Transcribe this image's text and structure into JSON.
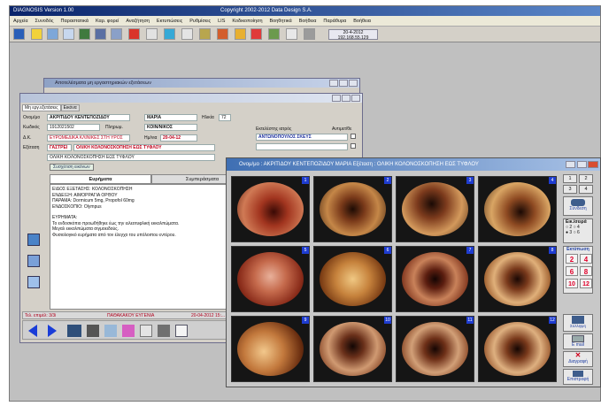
{
  "app": {
    "title": "DIAGNOSIS Version 1.00",
    "copyright": "Copyright 2002-2012 Data Design S.A."
  },
  "menu": [
    "Αρχεία",
    "Συνοδός",
    "Παραστατικά",
    "Καρ. φορεί",
    "Αναζήτηση",
    "Εκτυπώσεις",
    "Ρυθμίσεις",
    "LIS",
    "Κοδικοποίηση",
    "Βοηθητικά",
    "Βοήθεια",
    "Παράθυρα",
    "Βοήθεια"
  ],
  "datetime": {
    "date": "20-4-2012",
    "ip": "192.168.55.129"
  },
  "bg_window": {
    "title": "Αποτελέσματα μη εργαστηριακών εξετάσεων"
  },
  "patient_window": {
    "tabs": [
      "Μη εργ.εξετάσεις",
      "Εικόνα"
    ],
    "name_label": "Ονομ/μο",
    "surname": "ΑΚΡΙΤΙΔΟΥ ΚΕΝΤΕΠΟΖΙΔΟΥ",
    "first_name": "ΜΑΡΙΑ",
    "age_label": "Ηλικία",
    "age": "72",
    "code_label": "Κωδικός",
    "code": "1912021502",
    "payer_label": "Πληρωμ.",
    "payer": "ΚΟΙΝ/ΝΙΚΟΣ",
    "doctor_label": "Δ.Κ.",
    "doctor": "ΕΥΡΩΜΕΔΙΚΑ ΚΛΙΝΙΚΕΣ ΣΤΗ ΥΡΟΣ",
    "date_label": "Ημ/νια",
    "date": "20-04-12",
    "exam_label": "Εξέταση",
    "exam_code": "ΓΑΣΤΡΕΙ",
    "exam": "ΟΛΙΚΗ ΚΟΛΟΝΟΣΚΟΠΗΣΗ ΕΩΣ ΤΥΦΛΟΥ",
    "exam_line": "ΟΛΙΚΗ ΚΟΛΟΝΟΣΚΟΠΗΣΗ ΕΩΣ ΤΥΦΛΟΥ",
    "link_btn": "Συσχέτιση εικόνων",
    "sub_tabs": [
      "Ευρήματα",
      "Συμπεράσματα"
    ],
    "report": [
      "ΕΙΔΟΣ ΕΞΕΤΑΣΗΣ: ΚΟΛΟΝΟΣΚΟΠΗΣΗ",
      "ΕΝΔΕΙΞΗ: ΑΙΜΟΡΡΑΓΙΑ ΟΡΘΟΥ",
      "ΠΑΡΑΜΑ: Dormicum 5mg, Propofol 60mg",
      "ΕΝΔΟΣΚΟΠΙΟ: Olympus",
      "",
      "ΕΥΡΗΜΑΤΑ:",
      "Το ενδοσκόπιο προωθήθηκε έως την ειλεοτυφλική εκκολπώματα.",
      "Μεγαλ εκκολπώματα σιγμοειδούς.",
      "Φυσιολογικό ευρήματα από τον έλεγχο του υπόλοιπου εντέρου."
    ],
    "physician_label": "Εκτελέστης ιατρός",
    "physician": "ΑΝΤΩΝΟΠΟΥΛΟΣ ΣΚΕΥΣ",
    "approved_label": "Αντιμετ/θε",
    "status_left": "Τελ. επιμέλ: 3/3i",
    "status_mid": "ΠΑΘΑΚΑΚΟΥ ΕΥΓΕΝΙΑ",
    "status_right": "20-04-2012 15:..."
  },
  "gallery": {
    "title": "Ονομ/μο : ΑΚΡΙΤΙΔΟΥ ΚΕΝΤΕΠΟΖΙΔΟΥ ΜΑΡΙΑ  Εξέταση : ΟΛΙΚΗ ΚΟΛΟΝΟΣΚΟΠΗΣΗ ΕΩΣ ΤΥΦΛΟΥ",
    "images": [
      "1",
      "2",
      "3",
      "4",
      "5",
      "6",
      "7",
      "8",
      "9",
      "10",
      "11",
      "12"
    ],
    "view_btns": [
      "1",
      "2",
      "3",
      "4"
    ],
    "link_label": "Σύνδεση",
    "per_row_label": "Εικ./σειρά",
    "per_row_options": [
      "2",
      "4",
      "3",
      "6"
    ],
    "print_label": "Εκτύπωση",
    "print_options": [
      "2",
      "4",
      "6",
      "8",
      "10",
      "12"
    ],
    "capture_label": "Σύλληψη",
    "email_label": "E mail",
    "delete_label": "Διαγραφή",
    "back_label": "Επιστροφή"
  }
}
